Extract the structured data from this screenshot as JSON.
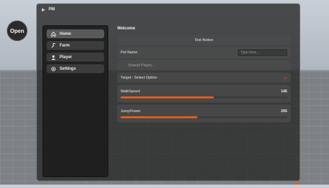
{
  "open_button": {
    "label": "Open"
  },
  "window": {
    "title": "PM",
    "accent": "#e85a1c"
  },
  "sidebar": {
    "items": [
      {
        "label": "Home",
        "icon": "home-icon",
        "active": true
      },
      {
        "label": "Farm",
        "icon": "wrench-icon",
        "active": false
      },
      {
        "label": "Player",
        "icon": "user-icon",
        "active": false
      },
      {
        "label": "Settings",
        "icon": "gear-icon",
        "active": false
      }
    ]
  },
  "main": {
    "section_title": "Welcome",
    "test_button": "Test Button",
    "pet_name": {
      "label": "Pet Name",
      "placeholder": "Type here..."
    },
    "search": {
      "placeholder": "Search Player..."
    },
    "target": {
      "label": "Target : Select Option"
    },
    "walkspeed": {
      "label": "WalkSpeed",
      "value": "145",
      "fill_fraction": 0.56
    },
    "jumppower": {
      "label": "JumpPower",
      "value": "255",
      "fill_fraction": 0.46
    }
  }
}
